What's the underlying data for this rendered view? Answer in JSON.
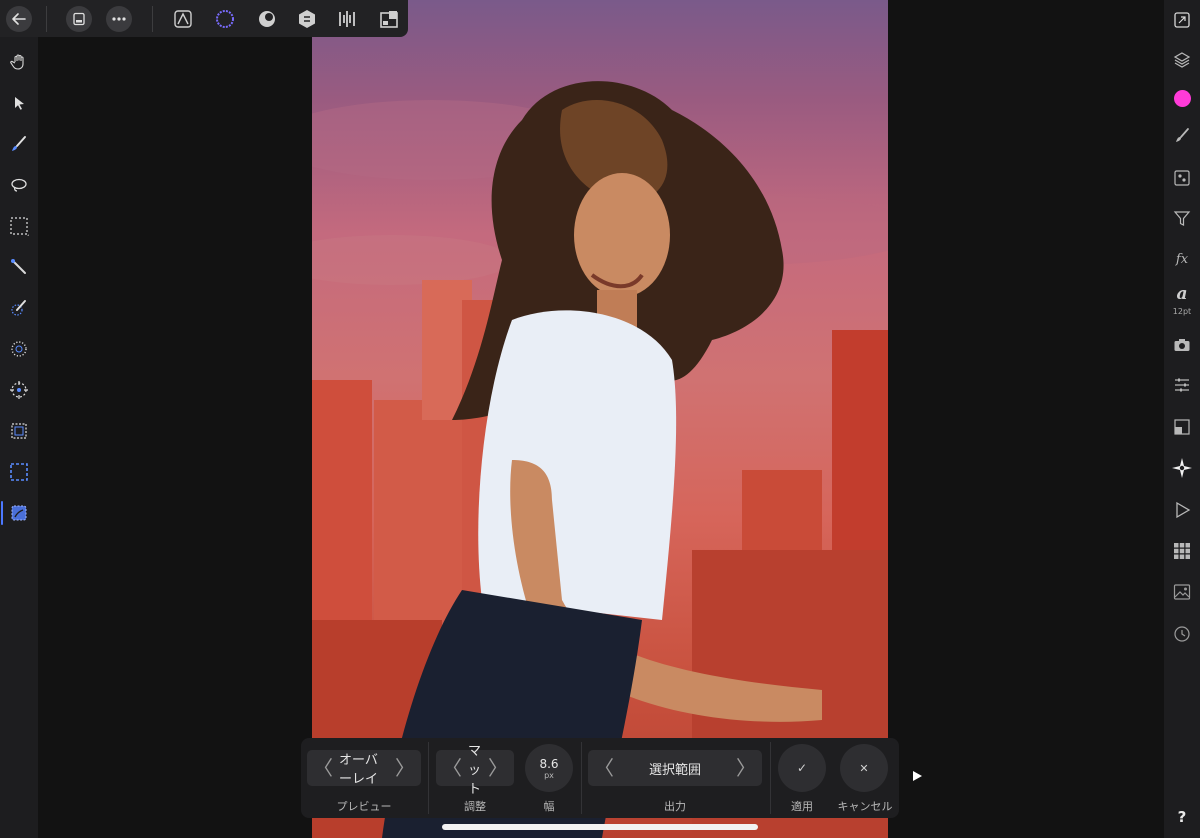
{
  "top_toolbar": {
    "icons": [
      "back-arrow-icon",
      "document-icon",
      "more-icon",
      "photo-persona-icon",
      "liquify-persona-icon",
      "develop-persona-icon",
      "tone-mapping-persona-icon",
      "export-persona-icon",
      "layout-persona-icon"
    ]
  },
  "left_tools": {
    "icons": [
      "hand-icon",
      "move-icon",
      "paint-brush-icon",
      "lasso-icon",
      "marquee-icon",
      "flood-select-icon",
      "selection-brush-icon",
      "freehand-selection-icon",
      "refine-icon",
      "rectangle-selection-icon",
      "quick-mask-icon",
      "refine-selection-icon"
    ],
    "active": "refine-selection-icon"
  },
  "right_studio": {
    "icons": [
      "fullscreen-icon",
      "layers-icon",
      "color-icon",
      "brush-icon",
      "channels-icon",
      "filter-icon",
      "fx-icon",
      "text-style-icon",
      "camera-icon",
      "adjustment-icon",
      "transform-icon",
      "navigator-icon",
      "macro-icon",
      "swatches-icon",
      "stock-icon",
      "history-icon"
    ],
    "color_swatch": "#ff3bd8",
    "fx_label": "fx",
    "text_label": "a",
    "text_size": "12pt"
  },
  "context_toolbar": {
    "preview": {
      "value": "オーバーレイ",
      "label": "プレビュー"
    },
    "adjust": {
      "value": "マット",
      "label": "調整"
    },
    "width": {
      "value": "8.6",
      "unit": "px",
      "label": "幅"
    },
    "output": {
      "value": "選択範囲",
      "label": "出力"
    },
    "apply": {
      "icon": "✓",
      "label": "適用"
    },
    "cancel": {
      "icon": "✕",
      "label": "キャンセル"
    }
  },
  "help": "?",
  "colors": {
    "accent": "#4c78ff",
    "panel": "#1d1d1f",
    "overlay_red": "#d6655a"
  }
}
